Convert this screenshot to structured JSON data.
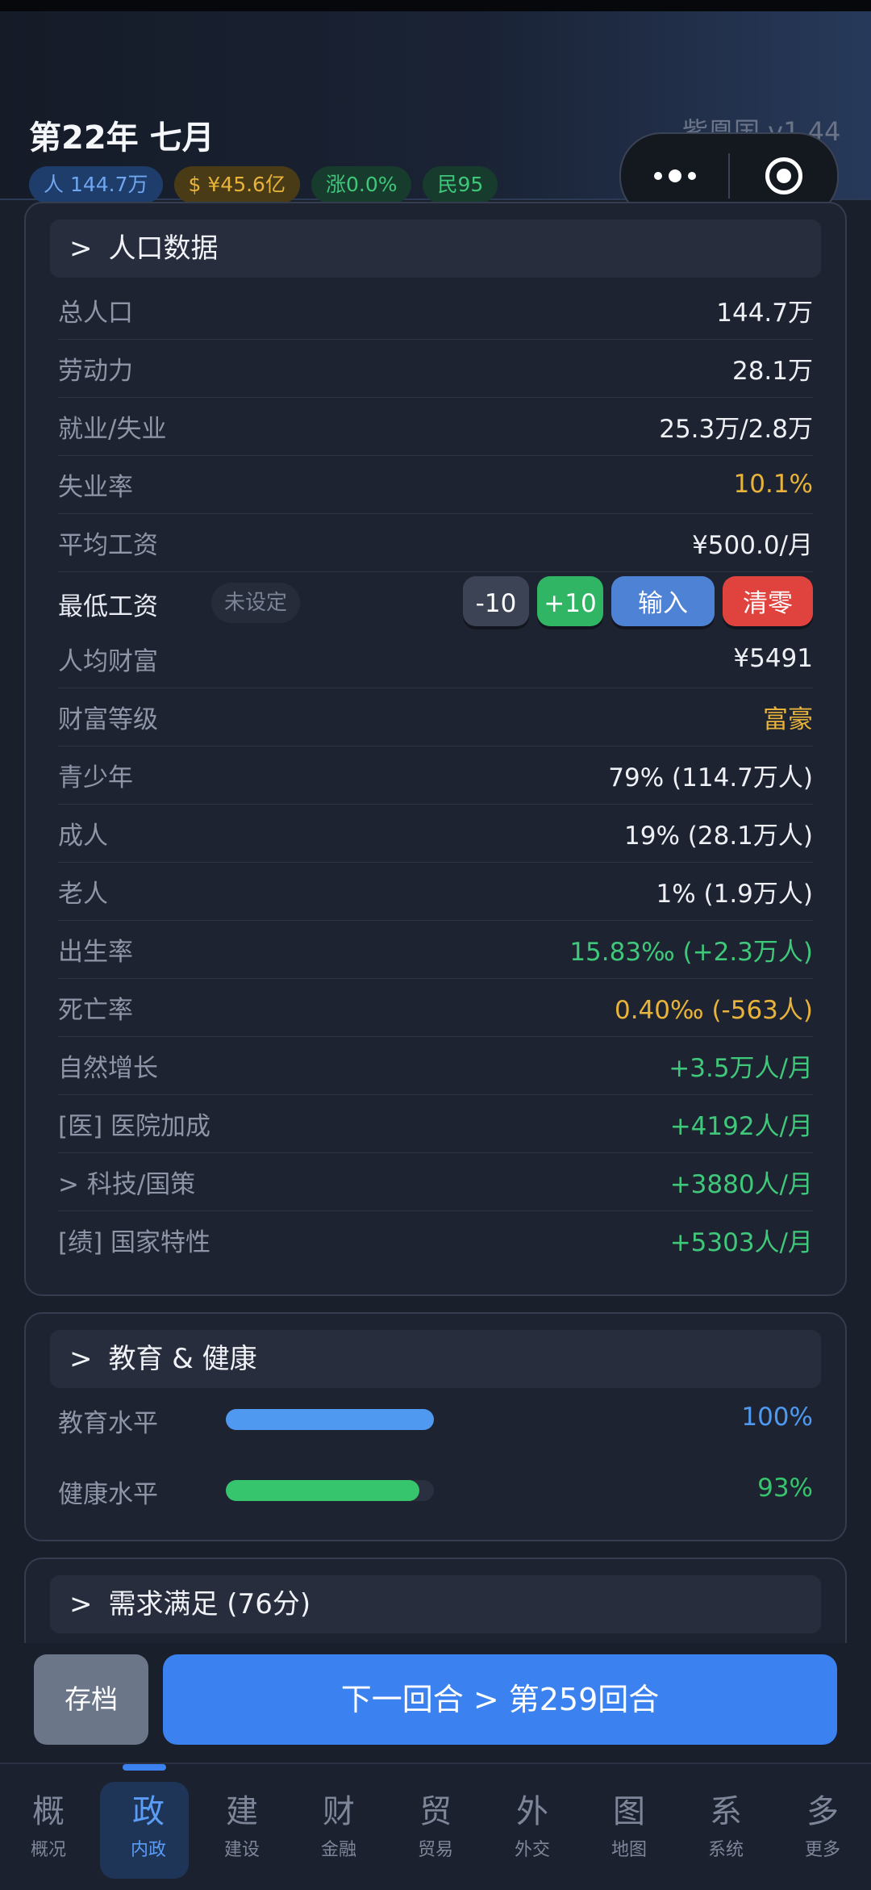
{
  "header": {
    "title": "第22年 七月",
    "country_version": "紫凰国 v1.44",
    "pills": {
      "population": "人 144.7万",
      "money": "$ ¥45.6亿",
      "rise": "涨0.0%",
      "people": "民95"
    }
  },
  "population_panel": {
    "title": "人口数据",
    "rows": [
      {
        "k": "总人口",
        "v": "144.7万"
      },
      {
        "k": "劳动力",
        "v": "28.1万"
      },
      {
        "k": "就业/失业",
        "v": "25.3万/2.8万"
      },
      {
        "k": "失业率",
        "v": "10.1%"
      },
      {
        "k": "平均工资",
        "v": "¥500.0/月"
      }
    ],
    "min_wage": {
      "label": "最低工资",
      "tag": "未设定",
      "minus": "-10",
      "plus": "+10",
      "input": "输入",
      "clear": "清零"
    },
    "rows2": [
      {
        "k": "人均财富",
        "v": "¥5491"
      },
      {
        "k": "财富等级",
        "v": "富豪"
      },
      {
        "k": "青少年",
        "v": "79% (114.7万人)"
      },
      {
        "k": "成人",
        "v": "19% (28.1万人)"
      },
      {
        "k": "老人",
        "v": "1% (1.9万人)"
      },
      {
        "k": "出生率",
        "v": "15.83‰ (+2.3万人)"
      },
      {
        "k": "死亡率",
        "v": "0.40‰ (-563人)"
      },
      {
        "k": "自然增长",
        "v": "+3.5万人/月"
      },
      {
        "k": "[医] 医院加成",
        "v": "+4192人/月"
      },
      {
        "k": "> 科技/国策",
        "v": "+3880人/月"
      },
      {
        "k": "[绩] 国家特性",
        "v": "+5303人/月"
      }
    ]
  },
  "edu_panel": {
    "title": "教育 & 健康",
    "education": {
      "label": "教育水平",
      "percent": 100,
      "text": "100%",
      "color": "#4f9af0"
    },
    "health": {
      "label": "健康水平",
      "percent": 93,
      "text": "93%",
      "color": "#36c46d"
    }
  },
  "demand_panel": {
    "title": "需求满足 (76分)"
  },
  "actions": {
    "save": "存档",
    "next": "下一回合 > 第259回合"
  },
  "tabs": [
    {
      "g": "概",
      "l": "概况"
    },
    {
      "g": "政",
      "l": "内政",
      "active": true
    },
    {
      "g": "建",
      "l": "建设"
    },
    {
      "g": "财",
      "l": "金融"
    },
    {
      "g": "贸",
      "l": "贸易"
    },
    {
      "g": "外",
      "l": "外交"
    },
    {
      "g": "图",
      "l": "地图"
    },
    {
      "g": "系",
      "l": "系统"
    },
    {
      "g": "多",
      "l": "更多"
    }
  ],
  "colors": {
    "accent": "#3b82f0",
    "green": "#3fc77a",
    "yellow": "#e8b33a",
    "red": "#e0423d"
  }
}
